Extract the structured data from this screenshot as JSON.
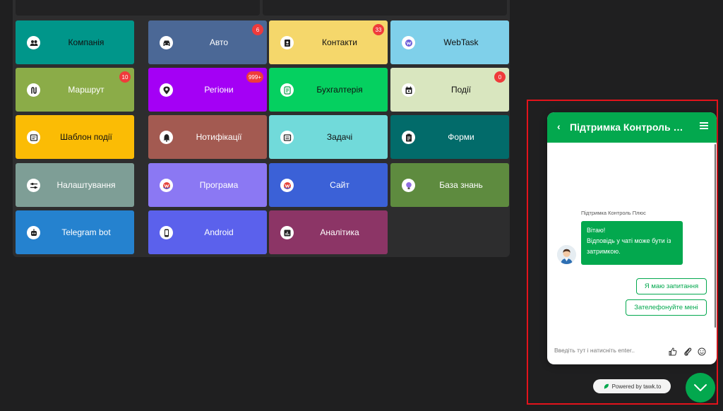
{
  "tiles": [
    {
      "label": "Компанія",
      "icon": "people-icon",
      "color": "#00968a",
      "dark": true,
      "badge": ""
    },
    {
      "label": "Авто",
      "icon": "car-icon",
      "color": "#4b6896",
      "dark": false,
      "badge": "6"
    },
    {
      "label": "Контакти",
      "icon": "contacts-book-icon",
      "color": "#f5d76b",
      "dark": true,
      "badge": "33"
    },
    {
      "label": "WebTask",
      "icon": "webtask-logo-icon",
      "color": "#7fd0ea",
      "dark": true,
      "badge": ""
    },
    {
      "label": "Маршрут",
      "icon": "route-icon",
      "color": "#8bac48",
      "dark": false,
      "badge": "10"
    },
    {
      "label": "Регіони",
      "icon": "location-pin-icon",
      "color": "#a400f5",
      "dark": false,
      "badge": "999+"
    },
    {
      "label": "Бухгалтерія",
      "icon": "accounting-icon",
      "color": "#05d060",
      "dark": true,
      "badge": ""
    },
    {
      "label": "Події",
      "icon": "calendar-icon",
      "color": "#d9e6bf",
      "dark": true,
      "badge": "0"
    },
    {
      "label": "Шаблон події",
      "icon": "template-icon",
      "color": "#fbbc05",
      "dark": true,
      "badge": ""
    },
    {
      "label": "Нотифікації",
      "icon": "bell-icon",
      "color": "#a35a51",
      "dark": false,
      "badge": ""
    },
    {
      "label": "Задачі",
      "icon": "tasks-icon",
      "color": "#71dada",
      "dark": true,
      "badge": ""
    },
    {
      "label": "Форми",
      "icon": "clipboard-icon",
      "color": "#026b6a",
      "dark": false,
      "badge": ""
    },
    {
      "label": "Налаштування",
      "icon": "settings-sliders-icon",
      "color": "#7e9e96",
      "dark": false,
      "badge": ""
    },
    {
      "label": "Програма",
      "icon": "program-logo-icon",
      "color": "#8b78f3",
      "dark": false,
      "badge": ""
    },
    {
      "label": "Сайт",
      "icon": "site-logo-icon",
      "color": "#3b61d7",
      "dark": false,
      "badge": ""
    },
    {
      "label": "База знань",
      "icon": "knowledge-bulb-icon",
      "color": "#5e8b3f",
      "dark": false,
      "badge": ""
    },
    {
      "label": "Telegram bot",
      "icon": "bot-icon",
      "color": "#2582cf",
      "dark": false,
      "badge": ""
    },
    {
      "label": "Android",
      "icon": "phone-icon",
      "color": "#5b61ec",
      "dark": false,
      "badge": ""
    },
    {
      "label": "Аналітика",
      "icon": "analytics-icon",
      "color": "#8c3566",
      "dark": false,
      "badge": ""
    }
  ],
  "chat": {
    "title": "Підтримка Контроль Плюс",
    "back_glyph": "‹",
    "agent_name": "Підтримка Контроль Плюс",
    "message_lines": [
      "Вітаю!",
      "Відповідь у чаті може бути із",
      "затримкою."
    ],
    "quick_replies": [
      "Я маю запитання",
      "Зателефонуйте мені"
    ],
    "input_placeholder": "Введіть тут і натисніть enter..",
    "powered_by": "Powered by tawk.to",
    "accent": "#03a84e"
  }
}
